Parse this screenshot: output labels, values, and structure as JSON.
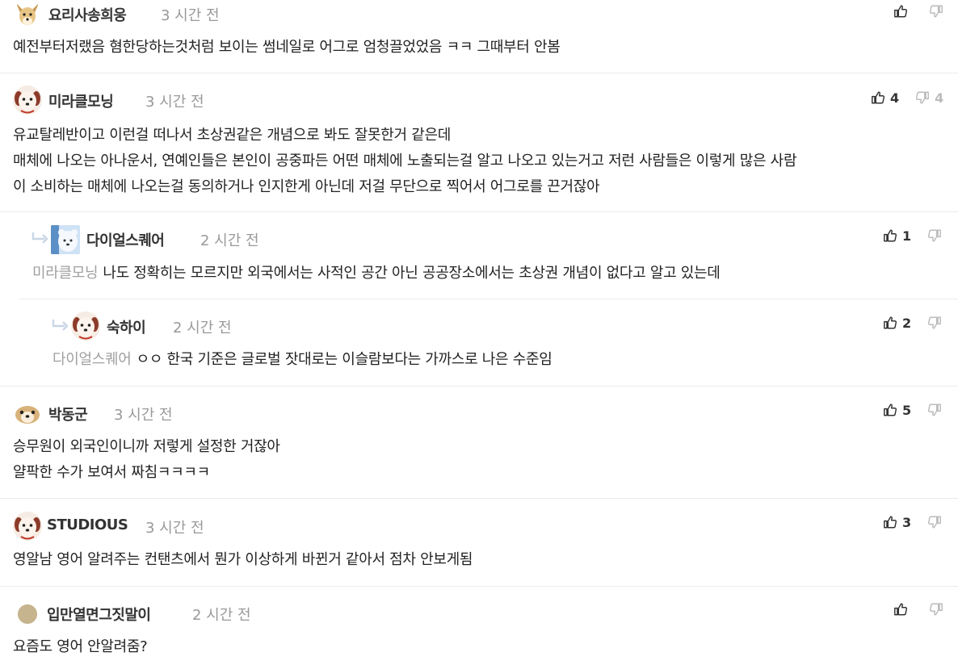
{
  "comments": [
    {
      "author": "요리사송희웅",
      "time": "3 시간 전",
      "lines": [
        "예전부터저랬음 혐한당하는것처럼 보이는 썸네일로 어그로 엄청끌었었음 ㅋㅋ 그때부터 안봄"
      ],
      "likes": "",
      "dislikes": ""
    },
    {
      "author": "미라클모닝",
      "time": "3 시간 전",
      "lines": [
        "유교탈레반이고 이런걸 떠나서 초상권같은 개념으로 봐도 잘못한거 같은데",
        "매체에 나오는 아나운서, 연예인들은 본인이 공중파든 어떤 매체에 노출되는걸 알고 나오고 있는거고 저런 사람들은 이렇게 많은 사람",
        "이 소비하는 매체에 나오는걸 동의하거나 인지한게 아닌데 저걸 무단으로 찍어서 어그로를 끈거잖아"
      ],
      "likes": "4",
      "dislikes": "4"
    },
    {
      "author": "다이얼스퀘어",
      "time": "2 시간 전",
      "mention": "미라클모닝",
      "lines": [
        "나도 정확히는 모르지만 외국에서는 사적인 공간 아닌 공공장소에서는 초상권 개념이 없다고 알고 있는데"
      ],
      "likes": "1",
      "dislikes": ""
    },
    {
      "author": "숙하이",
      "time": "2 시간 전",
      "mention": "다이얼스퀘어",
      "lines": [
        "ㅇㅇ 한국 기준은 글로벌 잣대로는 이슬람보다는 가까스로 나은 수준임"
      ],
      "likes": "2",
      "dislikes": ""
    },
    {
      "author": "박동군",
      "time": "3 시간 전",
      "lines": [
        "승무원이 외국인이니까 저렇게 설정한 거잖아",
        "얄팍한 수가 보여서 짜침ㅋㅋㅋㅋ"
      ],
      "likes": "5",
      "dislikes": ""
    },
    {
      "author": "STUDIOUS",
      "time": "3 시간 전",
      "lines": [
        "영알남 영어 알려주는 컨탠츠에서 뭔가 이상하게 바뀐거 같아서 점차 안보게됨"
      ],
      "likes": "3",
      "dislikes": ""
    },
    {
      "author": "입만열면그짓말이",
      "time": "2 시간 전",
      "lines": [
        "요즘도 영어 안알려줌?"
      ],
      "likes": "",
      "dislikes": ""
    }
  ],
  "icons": {
    "like": "thumbs-up-icon",
    "dislike": "thumbs-down-icon",
    "reply": "reply-arrow-icon"
  },
  "colors": {
    "author": "#333333",
    "time": "#999999",
    "mention": "#a0a0a0",
    "divider": "#ebebeb",
    "dislike_count": "#bbbbbb"
  }
}
